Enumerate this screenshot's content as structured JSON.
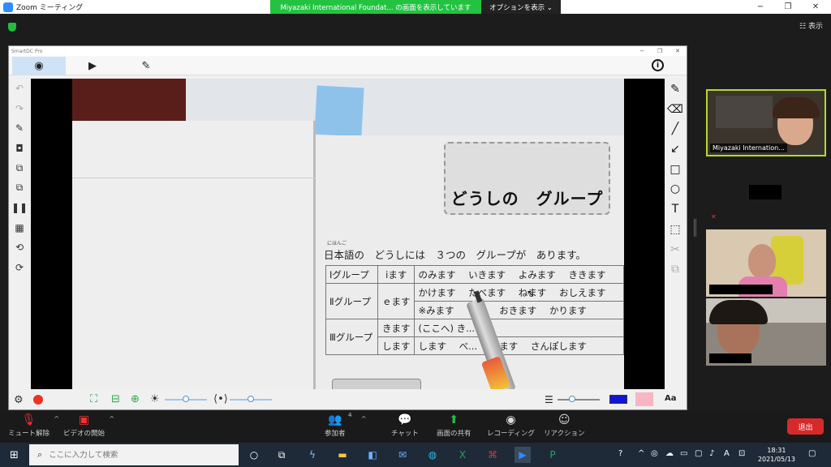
{
  "zoom": {
    "window_title": "Zoom ミーティング",
    "share_banner": "Miyazaki International Foundat... の画面を表示しています",
    "view_options": "オプションを表示 ⌄",
    "view_toggle": "表示",
    "win_min": "−",
    "win_max": "❐",
    "win_close": "✕"
  },
  "app": {
    "window_title": "SmartDC Pro",
    "tabs": [
      {
        "icon": "eye-icon",
        "glyph": "👁"
      },
      {
        "icon": "play-icon",
        "glyph": "▶"
      },
      {
        "icon": "edit-board-icon",
        "glyph": "✎"
      }
    ],
    "info": "i"
  },
  "textbook": {
    "heading": "どうしの　グループ",
    "intro": "日本語の　どうしには　３つの　グループが　あります。",
    "ruby_intro": "にほんご",
    "rows": [
      {
        "group": "Ⅰグループ",
        "suffix": "ⅰます",
        "ruby": "い",
        "words": [
          "のみます",
          "いきます",
          "よみます",
          "ききます"
        ]
      },
      {
        "group": "Ⅱグループ",
        "suffix": "ｅます",
        "ruby": "え",
        "words": [
          "かけます",
          "たべます",
          "ねます",
          "おしえます"
        ]
      },
      {
        "group": "",
        "suffix": "",
        "ruby": "",
        "words": [
          "※みます",
          "",
          "おきます",
          "かります"
        ]
      },
      {
        "group": "Ⅲグループ",
        "suffix": "きます",
        "ruby": "",
        "words": [
          "(ここへ) き..."
        ]
      },
      {
        "group": "",
        "suffix": "します",
        "ruby": "",
        "words": [
          "します",
          "べ...",
          "します",
          "さんぽします"
        ]
      }
    ]
  },
  "participants": [
    {
      "name": "Miyazaki Internation..."
    },
    {
      "name": ""
    },
    {
      "name": ""
    },
    {
      "name": ""
    }
  ],
  "controls": {
    "mute": "ミュート解除",
    "video": "ビデオの開始",
    "participants": "参加者",
    "participants_count": "4",
    "chat": "チャット",
    "share": "画面の共有",
    "record": "レコーディング",
    "reactions": "リアクション",
    "end": "退出"
  },
  "taskbar": {
    "search_placeholder": "ここに入力して検索",
    "time": "18:31",
    "date": "2021/05/13",
    "ime": "A"
  },
  "colors": {
    "share_green": "#23c341",
    "active_tile_border": "#b6d82b",
    "end_red": "#d62a2a",
    "pen_color": "#1414d8",
    "highlight_color": "#f7b7c2"
  }
}
